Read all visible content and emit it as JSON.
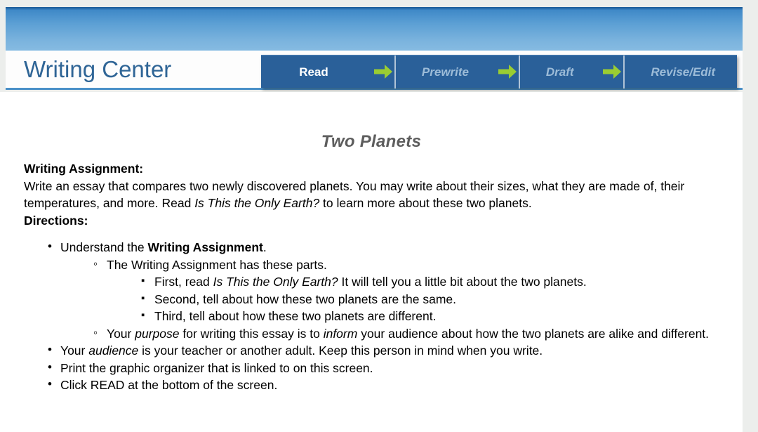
{
  "header": {
    "site_title": "Writing Center",
    "banner_color": "#5b9fd4",
    "nav_bg_color": "#2a6099",
    "arrow_color": "#9acd32",
    "steps": [
      {
        "label": "Read",
        "state": "current"
      },
      {
        "label": "Prewrite",
        "state": "todo"
      },
      {
        "label": "Draft",
        "state": "todo"
      },
      {
        "label": "Revise/Edit",
        "state": "todo"
      }
    ],
    "arrow_icon": "right-arrow-icon"
  },
  "document": {
    "title": "Two Planets",
    "assignment_label": "Writing Assignment:",
    "assignment_text_1": "Write an essay that compares two newly discovered planets. You may write about their sizes, what they are made of, their temperatures, and more. Read ",
    "assignment_book_title": "Is This the Only Earth?",
    "assignment_text_2": " to learn more about these two planets.",
    "directions_label": "Directions:",
    "bullets": {
      "b1_pre": "Understand the ",
      "b1_bold": "Writing Assignment",
      "b1_post": ".",
      "b2": "The Writing Assignment has these parts.",
      "b3_pre": "First, read ",
      "b3_it": "Is This the Only Earth?",
      "b3_post": " It will tell you a little bit about the two planets.",
      "b4": "Second, tell about how these two planets are the same.",
      "b5": "Third, tell about how these two planets are different.",
      "b6_pre": "Your ",
      "b6_it1": "purpose",
      "b6_mid": " for writing this essay is to ",
      "b6_it2": "inform",
      "b6_post": " your audience about how the two planets are alike and different.",
      "b7_pre": "Your ",
      "b7_it": "audience",
      "b7_post": " is your teacher or another adult. Keep this person in mind when you write.",
      "b8": "Print the graphic organizer that is linked to on this screen.",
      "b9": "Click READ at the bottom of the screen."
    }
  }
}
